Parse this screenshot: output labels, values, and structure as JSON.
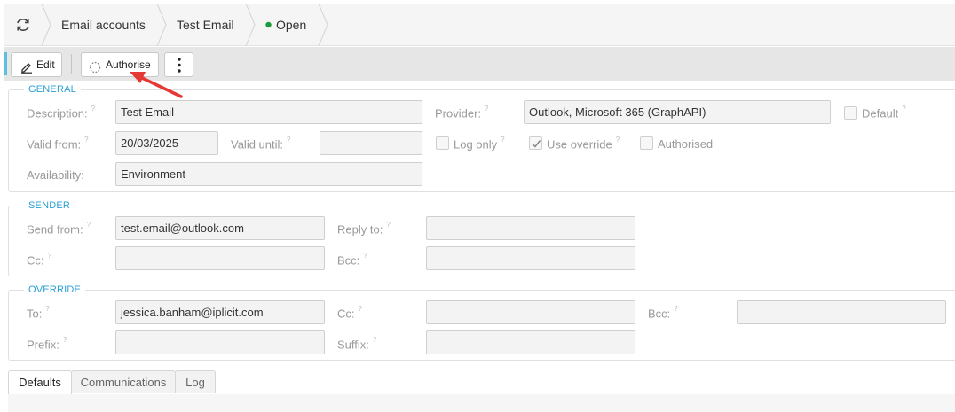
{
  "breadcrumb": {
    "items": [
      "Email accounts",
      "Test Email",
      "Open"
    ],
    "status_color": "#1a9b3a"
  },
  "toolbar": {
    "edit_label": "Edit",
    "authorise_label": "Authorise",
    "more_icon": "more-vertical-icon"
  },
  "general": {
    "legend": "GENERAL",
    "description_label": "Description:",
    "description_value": "Test Email",
    "provider_label": "Provider:",
    "provider_value": "Outlook, Microsoft 365 (GraphAPI)",
    "default_label": "Default",
    "default_checked": false,
    "valid_from_label": "Valid from:",
    "valid_from_value": "20/03/2025",
    "valid_until_label": "Valid until:",
    "valid_until_value": "",
    "log_only_label": "Log only",
    "log_only_checked": false,
    "use_override_label": "Use override",
    "use_override_checked": true,
    "authorised_label": "Authorised",
    "authorised_checked": false,
    "availability_label": "Availability:",
    "availability_value": "Environment"
  },
  "sender": {
    "legend": "SENDER",
    "send_from_label": "Send from:",
    "send_from_value": "test.email@outlook.com",
    "reply_to_label": "Reply to:",
    "reply_to_value": "",
    "cc_label": "Cc:",
    "cc_value": "",
    "bcc_label": "Bcc:",
    "bcc_value": ""
  },
  "override": {
    "legend": "OVERRIDE",
    "to_label": "To:",
    "to_value": "jessica.banham@iplicit.com",
    "cc_label": "Cc:",
    "cc_value": "",
    "bcc_label": "Bcc:",
    "bcc_value": "",
    "prefix_label": "Prefix:",
    "prefix_value": "",
    "suffix_label": "Suffix:",
    "suffix_value": ""
  },
  "help_mark": "?",
  "tabs": [
    {
      "label": "Defaults",
      "active": true
    },
    {
      "label": "Communications",
      "active": false
    },
    {
      "label": "Log",
      "active": false
    }
  ]
}
